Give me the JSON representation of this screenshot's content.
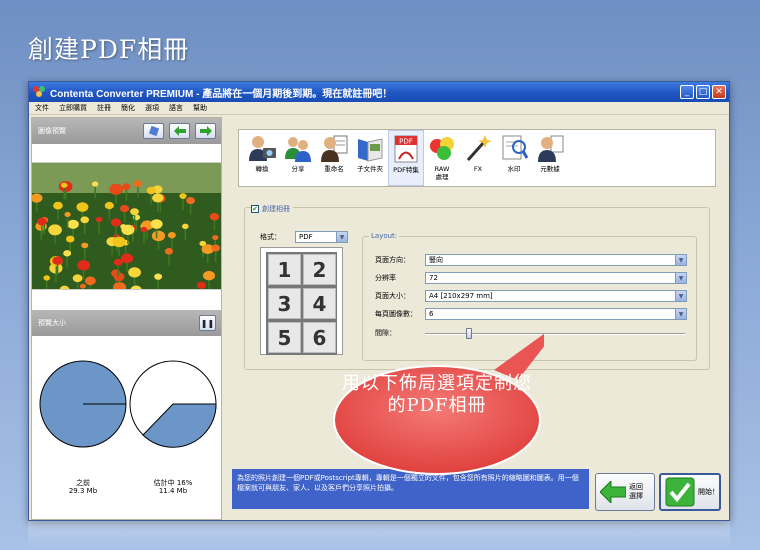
{
  "page_title": "創建PDF相冊",
  "window": {
    "title": "Contenta Converter PREMIUM - 產品將在一個月期後到期。現在就註冊吧！",
    "controls": {
      "minimize": "_",
      "maximize": "□",
      "close": "✕"
    }
  },
  "menu": [
    "文件",
    "立即購買",
    "註冊",
    "簡化",
    "選項",
    "語言",
    "幫助"
  ],
  "left_panel": {
    "preview_title": "圖像預覽",
    "thumb_title": "預覽大小",
    "before_label": "之前",
    "before_size": "29.3 Mb",
    "after_label": "估計中 16%",
    "after_size": "11.4 Mb",
    "pause_icon": "pause-icon"
  },
  "toolbar": {
    "tools": [
      {
        "label": "轉換",
        "icon": "person-camera-icon"
      },
      {
        "label": "分享",
        "icon": "people-icon"
      },
      {
        "label": "重命名",
        "icon": "person-document-icon"
      },
      {
        "label": "子文件夾",
        "icon": "folders-icon"
      },
      {
        "label": "PDF特集",
        "icon": "pdf-icon"
      },
      {
        "label": "RAW\n處理",
        "icon": "raw-balls-icon"
      },
      {
        "label": "FX",
        "icon": "fx-wand-icon"
      },
      {
        "label": "水印",
        "icon": "watermark-icon"
      },
      {
        "label": "元數據",
        "icon": "metadata-person-icon"
      }
    ]
  },
  "album": {
    "checkbox_label": "創建相冊",
    "format_label": "格式：",
    "format_value": "PDF",
    "grid_numbers": [
      "1",
      "2",
      "3",
      "4",
      "5",
      "6"
    ],
    "layout_title": "Layout:",
    "fields": [
      {
        "label": "頁面方向：",
        "value": "豎向"
      },
      {
        "label": "分辨率",
        "value": "72"
      },
      {
        "label": "頁面大小：",
        "value": "A4 [210x297 mm]"
      },
      {
        "label": "每頁圖像數：",
        "value": "6"
      }
    ],
    "spacing_label": "間隙：",
    "spacing_level": 0.16
  },
  "info_text": "為您的照片創建一個PDF或Postscript專輯，專輯是一個獨立的文件，包含您所有照片的縮略圖和圖表。用一個檔案就可與朋友、家人、以及客戶們分享照片拍攝。",
  "buttons": {
    "back": "返回\n選擇",
    "start": "開始！"
  },
  "callout_text": "用以下佈局選項定制您的PDF相冊",
  "colors": {
    "pie_fill": "#6d96c8",
    "info_bar": "#3f63c8",
    "callout": "#e8514f"
  }
}
